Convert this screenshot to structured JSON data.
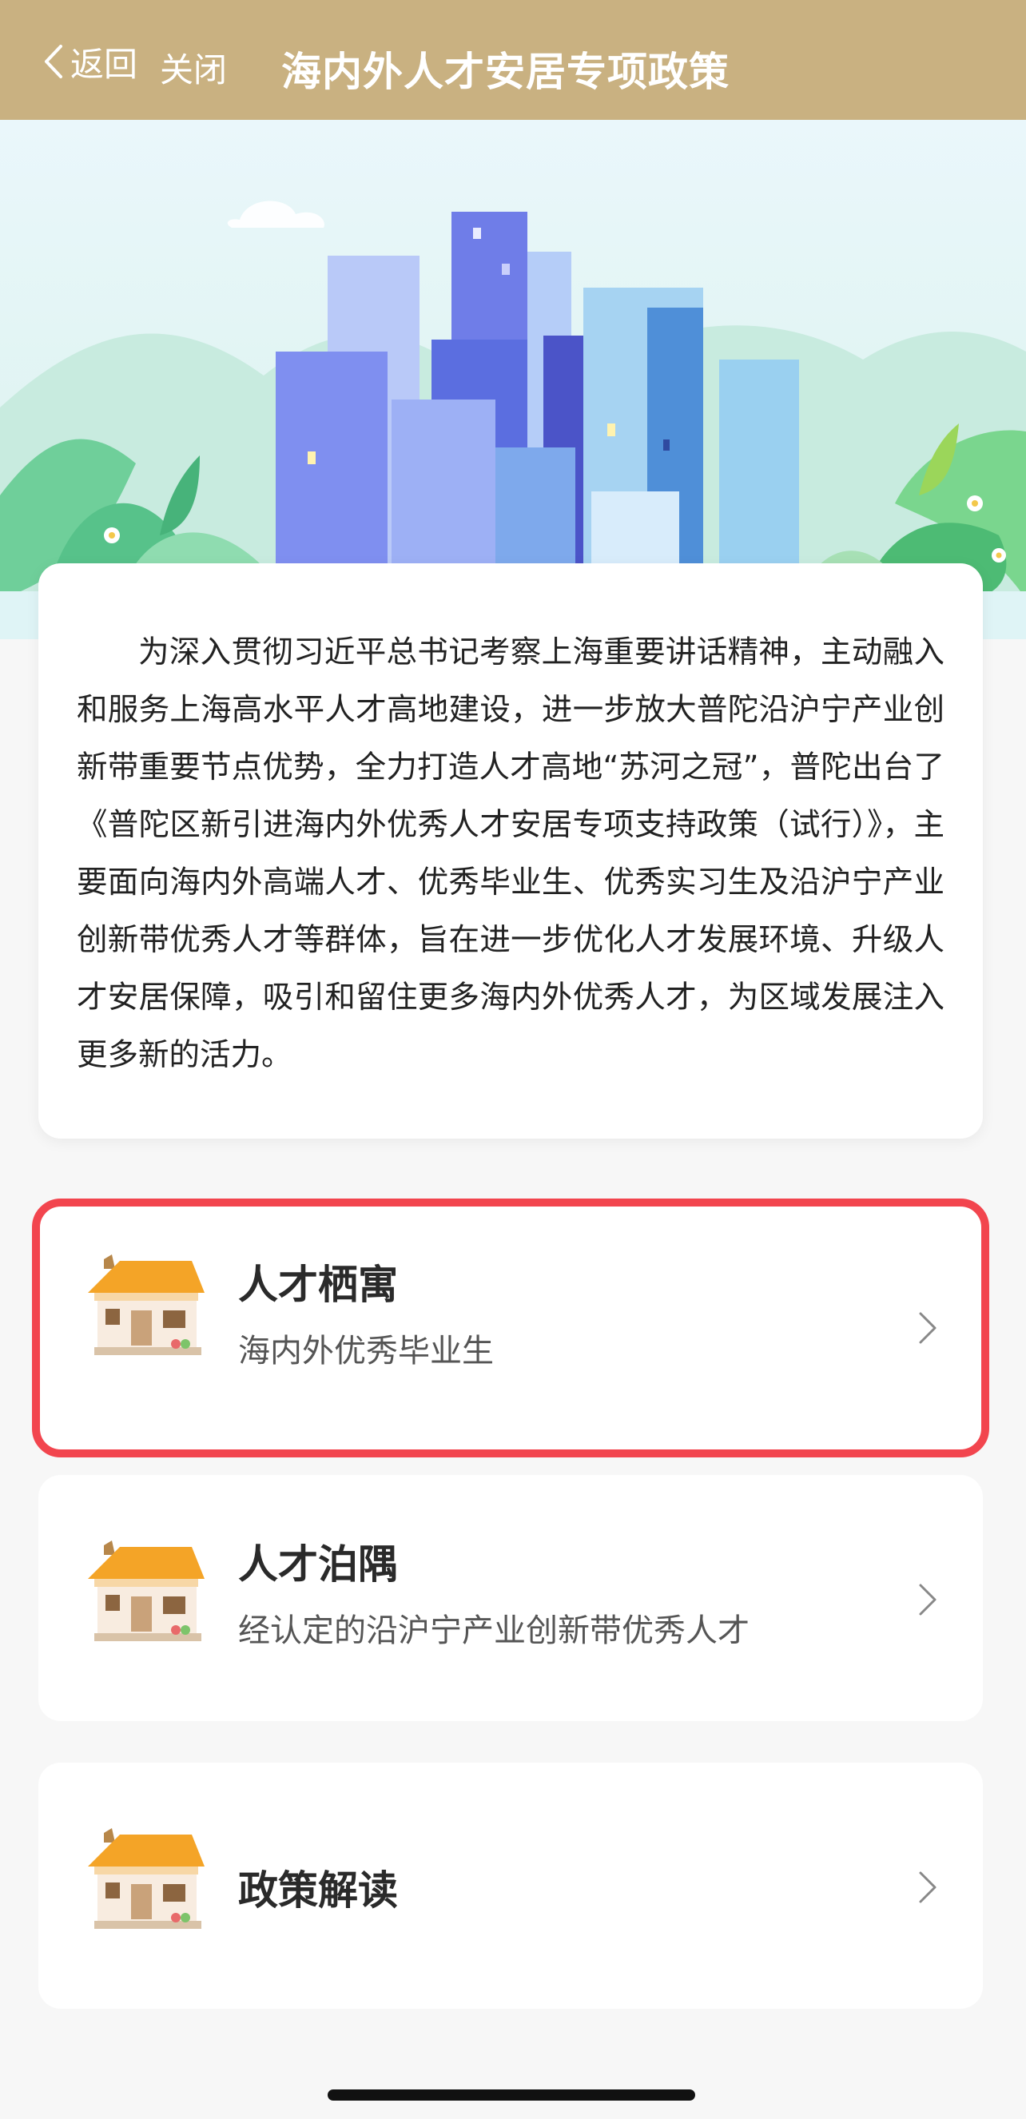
{
  "header": {
    "back_label": "返回",
    "close_label": "关闭",
    "title": "海内外人才安居专项政策"
  },
  "intro": {
    "text": "为深入贯彻习近平总书记考察上海重要讲话精神，主动融入和服务上海高水平人才高地建设，进一步放大普陀沿沪宁产业创新带重要节点优势，全力打造人才高地“苏河之冠”，普陀出台了《普陀区新引进海内外优秀人才安居专项支持政策（试行）》，主要面向海内外高端人才、优秀毕业生、优秀实习生及沿沪宁产业创新带优秀人才等群体，旨在进一步优化人才发展环境、升级人才安居保障，吸引和留住更多海内外优秀人才，为区域发展注入更多新的活力。"
  },
  "items": [
    {
      "title": "人才栖寓",
      "subtitle": "海内外优秀毕业生",
      "highlighted": true
    },
    {
      "title": "人才泊隅",
      "subtitle": "经认定的沿沪宁产业创新带优秀人才",
      "highlighted": false
    },
    {
      "title": "政策解读",
      "subtitle": "",
      "highlighted": false
    }
  ],
  "colors": {
    "header_bg": "#c9b181",
    "highlight_border": "#f2454e",
    "page_bg": "#f7f7f7"
  },
  "icons": {
    "back": "chevron-left-icon",
    "item_icon": "house-icon",
    "item_arrow": "chevron-right-icon"
  }
}
